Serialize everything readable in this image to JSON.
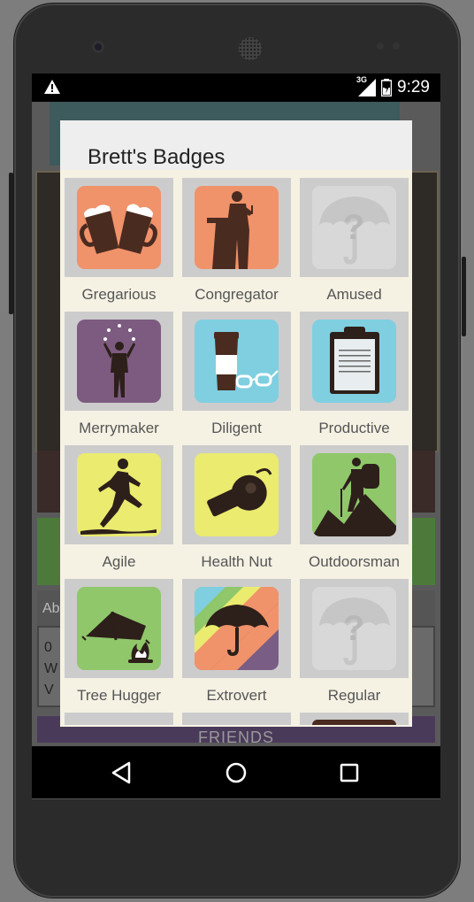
{
  "status_bar": {
    "time": "9:29",
    "network": "3G",
    "warning_icon": "warning-icon",
    "battery_icon": "battery-icon",
    "signal_icon": "signal-icon"
  },
  "background": {
    "about_label": "Ab",
    "card_lines": [
      "0",
      "W",
      "V"
    ],
    "friends_label": "FRIENDS"
  },
  "dialog": {
    "title": "Brett's Badges",
    "badges": [
      {
        "label": "Gregarious",
        "icon": "beer-mugs-icon",
        "color": "#f0926a"
      },
      {
        "label": "Congregator",
        "icon": "speaker-podium-icon",
        "color": "#f0926a"
      },
      {
        "label": "Amused",
        "icon": "locked-umbrella-question-icon",
        "color": "#d8d8d8"
      },
      {
        "label": "Merrymaker",
        "icon": "juggler-icon",
        "color": "#7d5b80"
      },
      {
        "label": "Diligent",
        "icon": "coffee-glasses-icon",
        "color": "#7fcfe0"
      },
      {
        "label": "Productive",
        "icon": "clipboard-icon",
        "color": "#7fcfe0"
      },
      {
        "label": "Agile",
        "icon": "runner-icon",
        "color": "#eaeb6f"
      },
      {
        "label": "Health Nut",
        "icon": "whistle-icon",
        "color": "#eaeb6f"
      },
      {
        "label": "Outdoorsman",
        "icon": "hiker-icon",
        "color": "#8fc76a"
      },
      {
        "label": "Tree Hugger",
        "icon": "tent-campfire-icon",
        "color": "#8fc76a"
      },
      {
        "label": "Extrovert",
        "icon": "rainbow-umbrella-icon",
        "color": "#f0926a"
      },
      {
        "label": "Regular",
        "icon": "locked-umbrella-question-icon",
        "color": "#d8d8d8"
      }
    ]
  },
  "nav_bar": {
    "back_icon": "back-triangle-icon",
    "home_icon": "home-circle-icon",
    "recents_icon": "recents-square-icon"
  }
}
